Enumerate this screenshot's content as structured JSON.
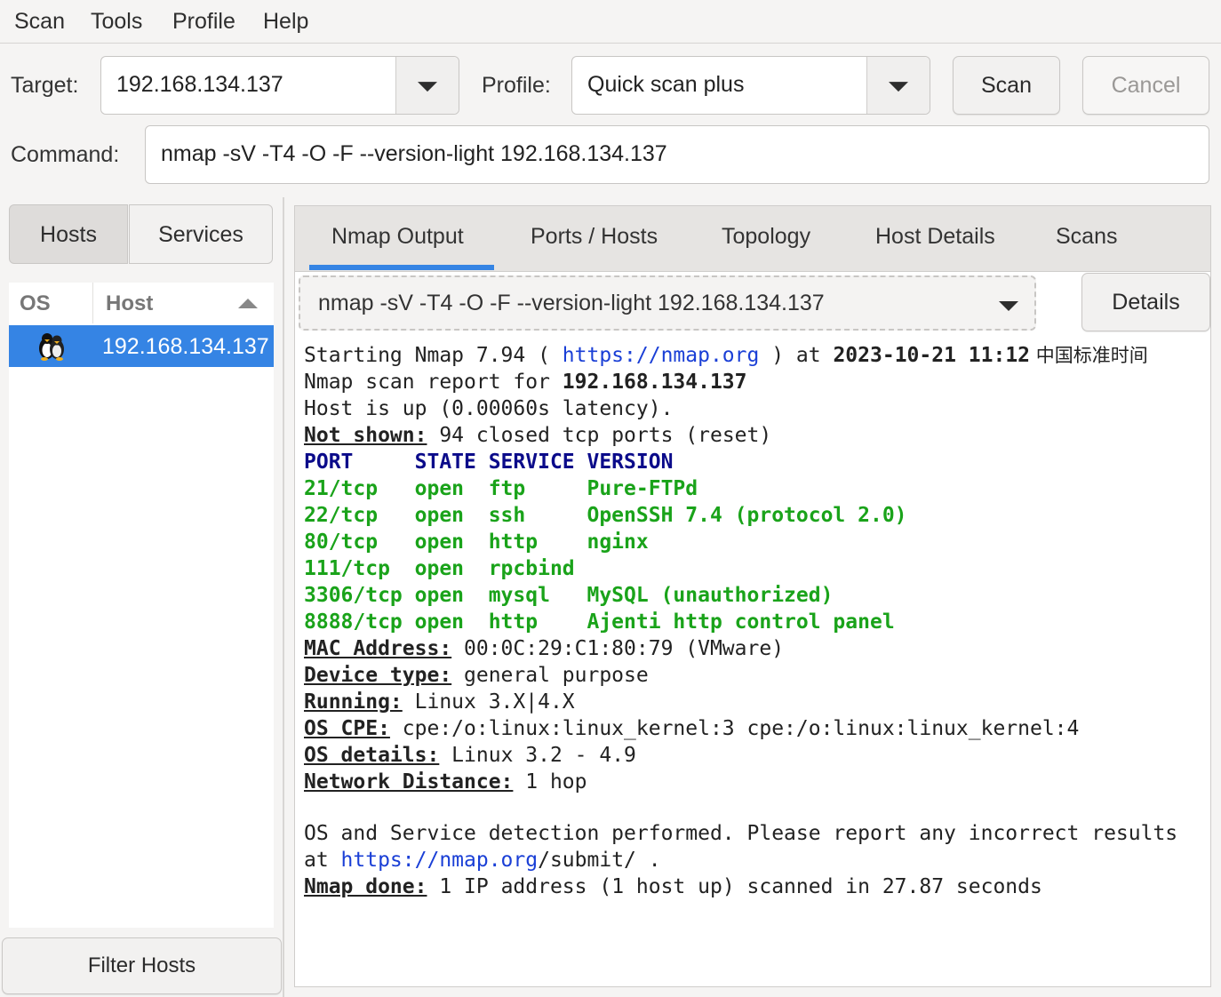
{
  "menu": [
    "Scan",
    "Tools",
    "Profile",
    "Help"
  ],
  "toolbar": {
    "target_label": "Target:",
    "target_value": "192.168.134.137",
    "profile_label": "Profile:",
    "profile_value": "Quick scan plus",
    "scan_button": "Scan",
    "cancel_button": "Cancel",
    "command_label": "Command:",
    "command_value": "nmap -sV -T4 -O -F --version-light 192.168.134.137"
  },
  "left": {
    "hosts_tab": "Hosts",
    "services_tab": "Services",
    "col_os": "OS",
    "col_host": "Host",
    "host_row": "192.168.134.137",
    "filter_button": "Filter Hosts"
  },
  "right": {
    "tabs": [
      "Nmap Output",
      "Ports / Hosts",
      "Topology",
      "Host Details",
      "Scans"
    ],
    "active_tab": "Nmap Output",
    "command_combo": "nmap -sV -T4 -O -F --version-light 192.168.134.137",
    "details_button": "Details"
  },
  "output": {
    "l1": {
      "a": "Starting Nmap 7.94 ( ",
      "link": "https://nmap.org",
      "b": " ) at ",
      "date": "2023-10-21 11:12",
      "tz": " 中国标准时间"
    },
    "l2": {
      "a": "Nmap scan report for ",
      "ip": "192.168.134.137"
    },
    "l3": "Host is up (0.00060s latency).",
    "l4": {
      "key": "Not shown:",
      "val": " 94 closed tcp ports (reset)"
    },
    "header": "PORT     STATE SERVICE VERSION",
    "ports": [
      "21/tcp   open  ftp     Pure-FTPd",
      "22/tcp   open  ssh     OpenSSH 7.4 (protocol 2.0)",
      "80/tcp   open  http    nginx",
      "111/tcp  open  rpcbind",
      "3306/tcp open  mysql   MySQL (unauthorized)",
      "8888/tcp open  http    Ajenti http control panel"
    ],
    "mac": {
      "key": "MAC Address:",
      "val": " 00:0C:29:C1:80:79 (VMware)"
    },
    "device": {
      "key": "Device type:",
      "val": " general purpose"
    },
    "running": {
      "key": "Running:",
      "val": " Linux 3.X|4.X"
    },
    "cpe": {
      "key": "OS CPE:",
      "val": " cpe:/o:linux:linux_kernel:3 cpe:/o:linux:linux_kernel:4"
    },
    "osd": {
      "key": "OS details:",
      "val": " Linux 3.2 - 4.9"
    },
    "netd": {
      "key": "Network Distance:",
      "val": " 1 hop"
    },
    "f1": "OS and Service detection performed. Please report any incorrect results",
    "f2": {
      "a": "at ",
      "link": "https://nmap.org",
      "b": "/submit/ ."
    },
    "done": {
      "key": "Nmap done:",
      "val": " 1 IP address (1 host up) scanned in 27.87 seconds"
    }
  },
  "colors": {
    "accent": "#3584e4",
    "port_green": "#1aa31a",
    "header_navy": "#0b0b8a",
    "link_blue": "#1a3fd6"
  }
}
